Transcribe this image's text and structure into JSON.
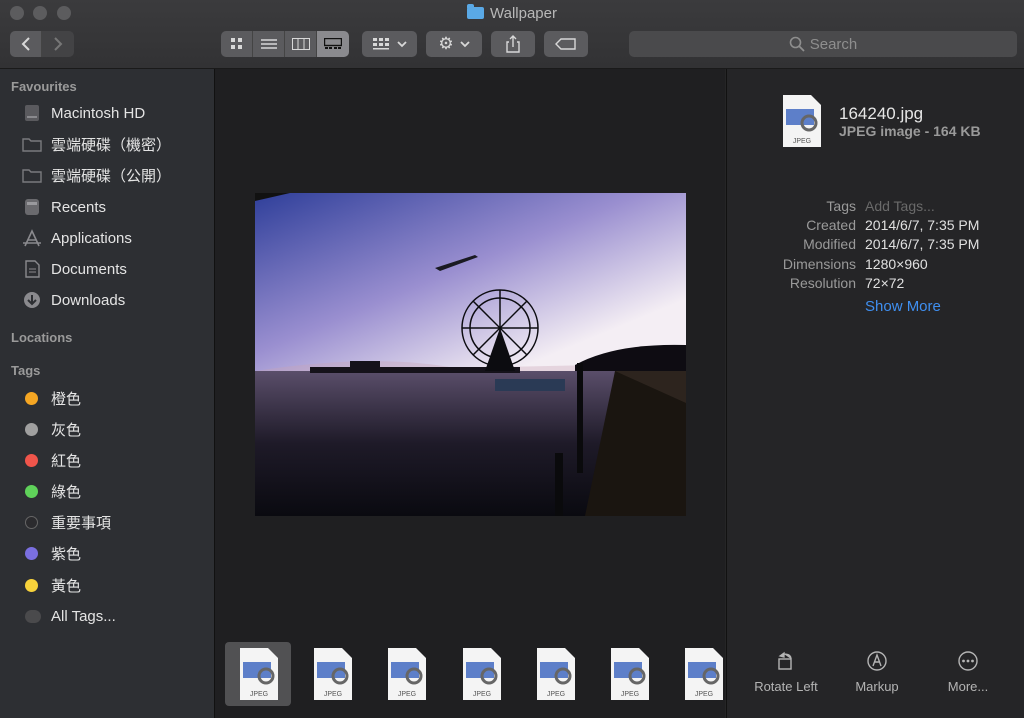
{
  "window": {
    "title": "Wallpaper"
  },
  "toolbar": {
    "search_placeholder": "Search",
    "view_modes": [
      "icon-view",
      "list-view",
      "column-view",
      "gallery-view"
    ],
    "active_view": "gallery-view"
  },
  "sidebar": {
    "favourites_heading": "Favourites",
    "favourites": [
      {
        "label": "Macintosh HD",
        "icon": "hard-drive-icon"
      },
      {
        "label": "雲端硬碟（機密）",
        "icon": "folder-icon"
      },
      {
        "label": "雲端硬碟（公開）",
        "icon": "folder-icon"
      },
      {
        "label": "Recents",
        "icon": "recents-icon"
      },
      {
        "label": "Applications",
        "icon": "applications-icon"
      },
      {
        "label": "Documents",
        "icon": "documents-icon"
      },
      {
        "label": "Downloads",
        "icon": "downloads-icon"
      }
    ],
    "locations_heading": "Locations",
    "tags_heading": "Tags",
    "tags": [
      {
        "label": "橙色",
        "color": "#f5a623"
      },
      {
        "label": "灰色",
        "color": "#a0a0a0"
      },
      {
        "label": "紅色",
        "color": "#f0554b"
      },
      {
        "label": "綠色",
        "color": "#5fd25a"
      },
      {
        "label": "重要事項",
        "color": "#2b2b2e"
      },
      {
        "label": "紫色",
        "color": "#7a6fe0"
      },
      {
        "label": "黃色",
        "color": "#f7d23b"
      },
      {
        "label": "All Tags...",
        "color": "#4a4a4c"
      }
    ]
  },
  "filmstrip": {
    "thumbs": [
      "JPEG",
      "JPEG",
      "JPEG",
      "JPEG",
      "JPEG",
      "JPEG",
      "JPEG"
    ],
    "selected_index": 0
  },
  "inspector": {
    "file_name": "164240.jpg",
    "file_kind": "JPEG image - 164 KB",
    "icon_label": "JPEG",
    "tags_label": "Tags",
    "tags_placeholder": "Add Tags...",
    "created_label": "Created",
    "created_value": "2014/6/7, 7:35 PM",
    "modified_label": "Modified",
    "modified_value": "2014/6/7, 7:35 PM",
    "dimensions_label": "Dimensions",
    "dimensions_value": "1280×960",
    "resolution_label": "Resolution",
    "resolution_value": "72×72",
    "show_more": "Show More"
  },
  "actions": [
    {
      "label": "Rotate Left",
      "icon": "rotate-left-icon"
    },
    {
      "label": "Markup",
      "icon": "markup-icon"
    },
    {
      "label": "More...",
      "icon": "more-icon"
    }
  ],
  "colors": {
    "accent": "#3f8ff0",
    "sidebar_bg": "#2d2f33",
    "preview_bg": "#1f1f21"
  }
}
